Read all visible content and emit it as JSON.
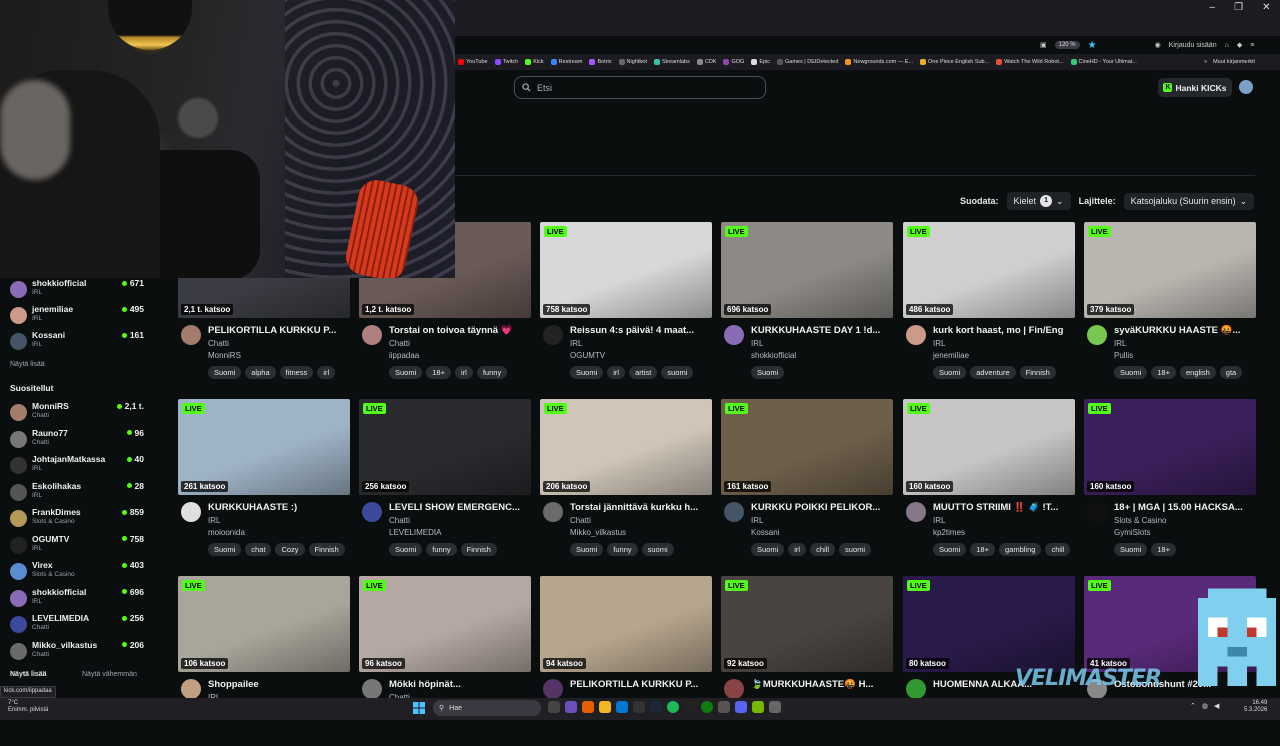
{
  "browser": {
    "zoom": "120 %",
    "signin": "Kirjaudu sisään",
    "bookmarks": [
      {
        "label": "YouTube",
        "color": "#ff0000"
      },
      {
        "label": "Twitch",
        "color": "#9146ff"
      },
      {
        "label": "Kick",
        "color": "#53fc18"
      },
      {
        "label": "Restream",
        "color": "#3b82f6"
      },
      {
        "label": "Botrix",
        "color": "#a855f7"
      },
      {
        "label": "Nightbot",
        "color": "#666666"
      },
      {
        "label": "Streamlabs",
        "color": "#31c3a2"
      },
      {
        "label": "CDK",
        "color": "#888888"
      },
      {
        "label": "GOG",
        "color": "#8e44ad"
      },
      {
        "label": "Epic",
        "color": "#dddddd"
      },
      {
        "label": "Games | DEIDetected",
        "color": "#555555"
      },
      {
        "label": "Newgrounds.com — E...",
        "color": "#f7941d"
      },
      {
        "label": "One Piece English Sub...",
        "color": "#e6b422"
      },
      {
        "label": "Watch The Wild Robot...",
        "color": "#e74c3c"
      },
      {
        "label": "CineHD - Your Ultimat...",
        "color": "#2ecc71"
      }
    ],
    "bookmarks_more": "Muut kirjanmerkit",
    "status_url": "kick.com/iippadaa"
  },
  "header": {
    "search_placeholder": "Etsi",
    "kick_button": "Hanki KICKs"
  },
  "filters": {
    "filter_label": "Suodata:",
    "languages_label": "Kielet",
    "languages_count": "1",
    "sort_label": "Lajittele:",
    "sort_value": "Katsojaluku (Suurin ensin)"
  },
  "sidebar": {
    "following": [
      {
        "name": "shokkiofficial",
        "cat": "IRL",
        "viewers": "671",
        "color": "#8a6bb5"
      },
      {
        "name": "jenemiliae",
        "cat": "IRL",
        "viewers": "495",
        "color": "#c99b88"
      },
      {
        "name": "Kossani",
        "cat": "IRL",
        "viewers": "161",
        "color": "#445566"
      }
    ],
    "show_more": "Näytä lisää",
    "recommended_heading": "Suositellut",
    "recommended": [
      {
        "name": "MonniRS",
        "cat": "Chatti",
        "viewers": "2,1 t.",
        "color": "#a47c6b"
      },
      {
        "name": "Rauno77",
        "cat": "Chatti",
        "viewers": "96",
        "color": "#777777"
      },
      {
        "name": "JohtajanMatkassa",
        "cat": "IRL",
        "viewers": "40",
        "color": "#333333"
      },
      {
        "name": "Eskolihakas",
        "cat": "IRL",
        "viewers": "28",
        "color": "#555555"
      },
      {
        "name": "FrankDimes",
        "cat": "Slots & Casino",
        "viewers": "859",
        "color": "#b59a57"
      },
      {
        "name": "OGUMTV",
        "cat": "IRL",
        "viewers": "758",
        "color": "#222222"
      },
      {
        "name": "Virex",
        "cat": "Slots & Casino",
        "viewers": "403",
        "color": "#5b8bd0"
      },
      {
        "name": "shokkiofficial",
        "cat": "IRL",
        "viewers": "696",
        "color": "#8a6bb5"
      },
      {
        "name": "LEVELIMEDIA",
        "cat": "Chatti",
        "viewers": "256",
        "color": "#3b4a9a"
      },
      {
        "name": "Mikko_vilkastus",
        "cat": "Chatti",
        "viewers": "206",
        "color": "#6a6a6a"
      }
    ],
    "show_more_2": "Näytä lisää",
    "show_less": "Näytä vähemmän"
  },
  "cards": [
    {
      "live": "",
      "viewers": "2,1 t. katsoo",
      "title": "PELIKORTILLA KURKKU P...",
      "cat": "Chatti",
      "user": "MonniRS",
      "tags": [
        "Suomi",
        "alpha",
        "fitness",
        "irl"
      ],
      "bg": "#3c3d44",
      "av": "#a47c6b"
    },
    {
      "live": "",
      "viewers": "1,2 t. katsoo",
      "title": "Torstai on toivoa täynnä 💗",
      "cat": "Chatti",
      "user": "iippadaa",
      "tags": [
        "Suomi",
        "18+",
        "irl",
        "funny"
      ],
      "bg": "#6a5a55",
      "av": "#b08080"
    },
    {
      "live": "LIVE",
      "viewers": "758 katsoo",
      "title": "Reissun 4:s päivä! 4 maat...",
      "cat": "IRL",
      "user": "OGUMTV",
      "tags": [
        "Suomi",
        "irl",
        "artist",
        "suomi"
      ],
      "bg": "#d8d8d8",
      "av": "#222222"
    },
    {
      "live": "LIVE",
      "viewers": "696 katsoo",
      "title": "KURKKUHAASTE DAY 1 !d...",
      "cat": "IRL",
      "user": "shokkiofficial",
      "tags": [
        "Suomi"
      ],
      "bg": "#8d8a85",
      "av": "#8a6bb5"
    },
    {
      "live": "LIVE",
      "viewers": "486 katsoo",
      "title": "kurk kort haast, mo | Fin/Eng",
      "cat": "IRL",
      "user": "jenemiliae",
      "tags": [
        "Suomi",
        "adventure",
        "Finnish"
      ],
      "bg": "#cfcfcf",
      "av": "#c99b88"
    },
    {
      "live": "LIVE",
      "viewers": "379 katsoo",
      "title": "syväKURKKU HAASTE 🤬...",
      "cat": "IRL",
      "user": "Pullis",
      "tags": [
        "Suomi",
        "18+",
        "english",
        "gta"
      ],
      "bg": "#b9b6b0",
      "av": "#78c850"
    },
    {
      "live": "LIVE",
      "viewers": "261 katsoo",
      "title": "KURKKUHAASTE :)",
      "cat": "IRL",
      "user": "moioonida",
      "tags": [
        "Suomi",
        "chat",
        "Cozy",
        "Finnish"
      ],
      "bg": "#9fb3c6",
      "av": "#e0e0e0"
    },
    {
      "live": "LIVE",
      "viewers": "256 katsoo",
      "title": "LEVELI SHOW EMERGENC...",
      "cat": "Chatti",
      "user": "LEVELIMEDIA",
      "tags": [
        "Suomi",
        "funny",
        "Finnish"
      ],
      "bg": "#2a2b2e",
      "av": "#3b4a9a"
    },
    {
      "live": "LIVE",
      "viewers": "206 katsoo",
      "title": "Torstai jännittävä kurkku h...",
      "cat": "Chatti",
      "user": "Mikko_vilkastus",
      "tags": [
        "Suomi",
        "funny",
        "suomi"
      ],
      "bg": "#cfc5b8",
      "av": "#6a6a6a"
    },
    {
      "live": "LIVE",
      "viewers": "161 katsoo",
      "title": "KURKKU POIKKI PELIKOR...",
      "cat": "IRL",
      "user": "Kossani",
      "tags": [
        "Suomi",
        "irl",
        "chill",
        "suomi"
      ],
      "bg": "#6e5f4b",
      "av": "#445566"
    },
    {
      "live": "LIVE",
      "viewers": "160 katsoo",
      "title": "MUUTTO STRIIMI ‼️ 🧳 !T...",
      "cat": "IRL",
      "user": "kp2times",
      "tags": [
        "Suomi",
        "18+",
        "gambling",
        "chill"
      ],
      "bg": "#c8c6c4",
      "av": "#887788"
    },
    {
      "live": "LIVE",
      "viewers": "160 katsoo",
      "title": "18+ | MGA | 15.00 HACKSA...",
      "cat": "Slots & Casino",
      "user": "GymiSlots",
      "tags": [
        "Suomi",
        "18+"
      ],
      "bg": "#3a1f5a",
      "av": "#111111"
    },
    {
      "live": "LIVE",
      "viewers": "106 katsoo",
      "title": "Shoppailee",
      "cat": "IRL",
      "user": "",
      "tags": [],
      "bg": "#a8a59a",
      "av": "#c0a080"
    },
    {
      "live": "LIVE",
      "viewers": "96 katsoo",
      "title": "Mökki höpinät...",
      "cat": "Chatti",
      "user": "",
      "tags": [],
      "bg": "#b5a8a2",
      "av": "#777777"
    },
    {
      "live": "",
      "viewers": "94 katsoo",
      "title": "PELIKORTILLA KURKKU P...",
      "cat": "",
      "user": "",
      "tags": [],
      "bg": "#b7a68e",
      "av": "#553366"
    },
    {
      "live": "LIVE",
      "viewers": "92 katsoo",
      "title": "🍃MURKKUHAASTE🤬 H...",
      "cat": "",
      "user": "",
      "tags": [],
      "bg": "#4a4440",
      "av": "#884444"
    },
    {
      "live": "LIVE",
      "viewers": "80 katsoo",
      "title": "HUOMENNA ALKAA...",
      "cat": "",
      "user": "",
      "tags": [],
      "bg": "#2a1a4a",
      "av": "#339933"
    },
    {
      "live": "LIVE",
      "viewers": "41 katsoo",
      "title": "Ostobonushunt #20...",
      "cat": "",
      "user": "",
      "tags": [],
      "bg": "#5a2a7a",
      "av": "#888888"
    }
  ],
  "taskbar": {
    "weather_temp": "7°C",
    "weather_desc": "Enimm. pilvistä",
    "search": "Hae",
    "time": "16.49",
    "date": "5.3.2026"
  },
  "watermark": "VELIMASTER"
}
